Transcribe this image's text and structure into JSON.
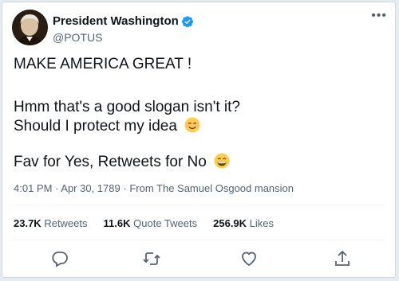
{
  "user": {
    "display_name": "President Washington",
    "handle": "@POTUS",
    "verified": true
  },
  "tweet": {
    "line1": "MAKE AMERICA GREAT !",
    "line2": "Hmm that's a good slogan isn't it?",
    "line3": "Should I protect my idea",
    "line3_emoji": "smiling-face-icon",
    "line4": "Fav for Yes, Retweets for No",
    "line4_emoji": "grinning-face-icon"
  },
  "meta": {
    "time": "4:01 PM",
    "date": "Apr 30, 1789",
    "source": "From The Samuel Osgood mansion"
  },
  "stats": {
    "retweets_count": "23.7K",
    "retweets_label": "Retweets",
    "quotes_count": "11.6K",
    "quotes_label": "Quote Tweets",
    "likes_count": "256.9K",
    "likes_label": "Likes"
  },
  "colors": {
    "accent": "#1d9bf0",
    "text": "#0f1419",
    "secondary": "#536471"
  },
  "actions": [
    "reply-icon",
    "retweet-icon",
    "like-icon",
    "share-icon"
  ]
}
